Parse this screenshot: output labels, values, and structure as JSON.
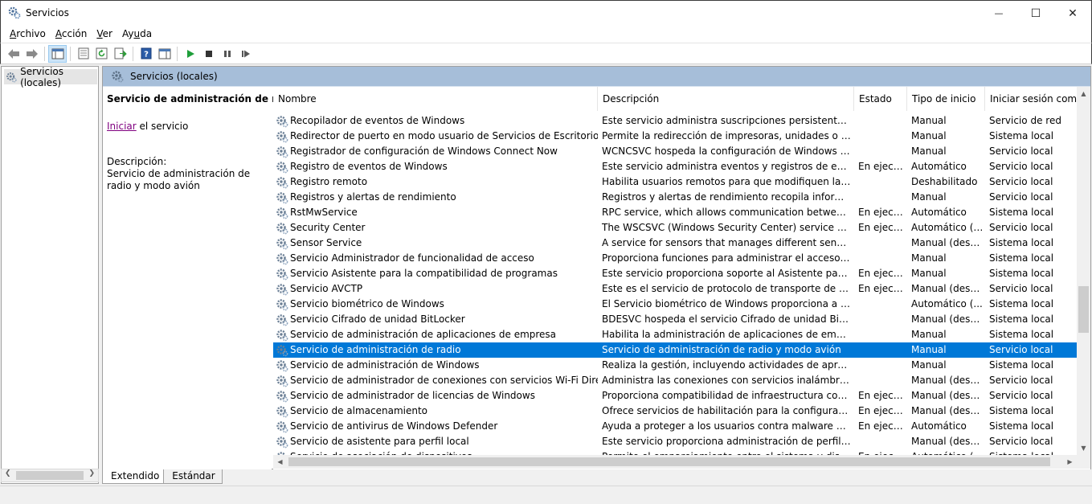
{
  "window": {
    "title": "Servicios",
    "minimize_glyph": "—",
    "maximize_glyph": "☐",
    "close_glyph": "✕"
  },
  "menu": [
    {
      "prefix": "",
      "accel": "A",
      "rest": "rchivo"
    },
    {
      "prefix": "",
      "accel": "A",
      "rest": "cción"
    },
    {
      "prefix": "",
      "accel": "V",
      "rest": "er"
    },
    {
      "prefix": "Ay",
      "accel": "u",
      "rest": "da"
    }
  ],
  "tree": {
    "root_label": "Servicios (locales)"
  },
  "pane": {
    "header": "Servicios (locales)",
    "selected_title": "Servicio de administración de radio",
    "start_link": "Iniciar",
    "start_rest": " el servicio",
    "desc_label": "Descripción:",
    "desc_text": "Servicio de administración de radio y modo avión"
  },
  "columns": {
    "name": "Nombre",
    "desc": "Descripción",
    "status": "Estado",
    "startup": "Tipo de inicio",
    "logon": "Iniciar sesión como"
  },
  "sort_glyph": "^",
  "rows": [
    {
      "name": "Recopilador de eventos de Windows",
      "desc": "Este servicio administra suscripciones persistentes a eve...",
      "status": "",
      "startup": "Manual",
      "logon": "Servicio de red"
    },
    {
      "name": "Redirector de puerto en modo usuario de Servicios de Escritorio remoto",
      "desc": "Permite la redirección de impresoras, unidades o puerto...",
      "status": "",
      "startup": "Manual",
      "logon": "Sistema local"
    },
    {
      "name": "Registrador de configuración de Windows Connect Now",
      "desc": "WCNCSVC hospeda la configuración de Windows Conn...",
      "status": "",
      "startup": "Manual",
      "logon": "Servicio local"
    },
    {
      "name": "Registro de eventos de Windows",
      "desc": "Este servicio administra eventos y registros de eventos. P...",
      "status": "En ejecu...",
      "startup": "Automático",
      "logon": "Servicio local"
    },
    {
      "name": "Registro remoto",
      "desc": "Habilita usuarios remotos para que modifiquen la config...",
      "status": "",
      "startup": "Deshabilitado",
      "logon": "Servicio local"
    },
    {
      "name": "Registros y alertas de rendimiento",
      "desc": "Registros y alertas de rendimiento recopila información ...",
      "status": "",
      "startup": "Manual",
      "logon": "Servicio local"
    },
    {
      "name": "RstMwService",
      "desc": "RPC service, which allows communication between driv...",
      "status": "En ejecu...",
      "startup": "Automático",
      "logon": "Sistema local"
    },
    {
      "name": "Security Center",
      "desc": "The WSCSVC (Windows Security Center) service monitor...",
      "status": "En ejecu...",
      "startup": "Automático (i...",
      "logon": "Servicio local"
    },
    {
      "name": "Sensor Service",
      "desc": "A service for sensors that manages different sensors' fun...",
      "status": "",
      "startup": "Manual (dese...",
      "logon": "Sistema local"
    },
    {
      "name": "Servicio Administrador de funcionalidad de acceso",
      "desc": "Proporciona funciones para administrar el acceso de apli...",
      "status": "",
      "startup": "Manual",
      "logon": "Sistema local"
    },
    {
      "name": "Servicio Asistente para la compatibilidad de programas",
      "desc": "Este servicio proporciona soporte al Asistente para la co...",
      "status": "En ejecu...",
      "startup": "Manual",
      "logon": "Sistema local"
    },
    {
      "name": "Servicio AVCTP",
      "desc": "Este es el servicio de protocolo de transporte de control ...",
      "status": "En ejecu...",
      "startup": "Manual (dese...",
      "logon": "Servicio local"
    },
    {
      "name": "Servicio biométrico de Windows",
      "desc": "El Servicio biométrico de Windows proporciona a las apli...",
      "status": "",
      "startup": "Automático (...",
      "logon": "Sistema local"
    },
    {
      "name": "Servicio Cifrado de unidad BitLocker",
      "desc": "BDESVC hospeda el servicio Cifrado de unidad BitLocker....",
      "status": "",
      "startup": "Manual (dese...",
      "logon": "Sistema local"
    },
    {
      "name": "Servicio de administración de aplicaciones de empresa",
      "desc": "Habilita la administración de aplicaciones de empresa.",
      "status": "",
      "startup": "Manual",
      "logon": "Sistema local"
    },
    {
      "name": "Servicio de administración de radio",
      "desc": "Servicio de administración de radio y modo avión",
      "status": "",
      "startup": "Manual",
      "logon": "Servicio local",
      "selected": true
    },
    {
      "name": "Servicio de administración de Windows",
      "desc": "Realiza la gestión, incluyendo actividades de aprovisiona...",
      "status": "",
      "startup": "Manual",
      "logon": "Sistema local"
    },
    {
      "name": "Servicio de administrador de conexiones con servicios Wi-Fi Direct",
      "desc": "Administra las conexiones con servicios inalámbricos, in...",
      "status": "",
      "startup": "Manual (dese...",
      "logon": "Servicio local"
    },
    {
      "name": "Servicio de administrador de licencias de Windows",
      "desc": "Proporciona compatibilidad de infraestructura con Micr...",
      "status": "En ejecu...",
      "startup": "Manual (dese...",
      "logon": "Servicio local"
    },
    {
      "name": "Servicio de almacenamiento",
      "desc": "Ofrece servicios de habilitación para la configuración de ...",
      "status": "En ejecu...",
      "startup": "Manual (dese...",
      "logon": "Sistema local"
    },
    {
      "name": "Servicio de antivirus de Windows Defender",
      "desc": "Ayuda a proteger a los usuarios contra malware y otro s...",
      "status": "En ejecu...",
      "startup": "Automático",
      "logon": "Sistema local"
    },
    {
      "name": "Servicio de asistente para perfil local",
      "desc": "Este servicio proporciona administración de perfil para l...",
      "status": "",
      "startup": "Manual (dese...",
      "logon": "Servicio local"
    },
    {
      "name": "Servicio de asociación de dispositivos",
      "desc": "Permite el emparejamiento entre el sistema y dispositivo...",
      "status": "En ejecu...",
      "startup": "Automático (...",
      "logon": "Sistema local"
    }
  ],
  "tabs": {
    "extended": "Extendido",
    "standard": "Estándar"
  },
  "colors": {
    "selection": "#0078d7",
    "pane_header": "#a6bed9",
    "link_visited": "#800080"
  }
}
